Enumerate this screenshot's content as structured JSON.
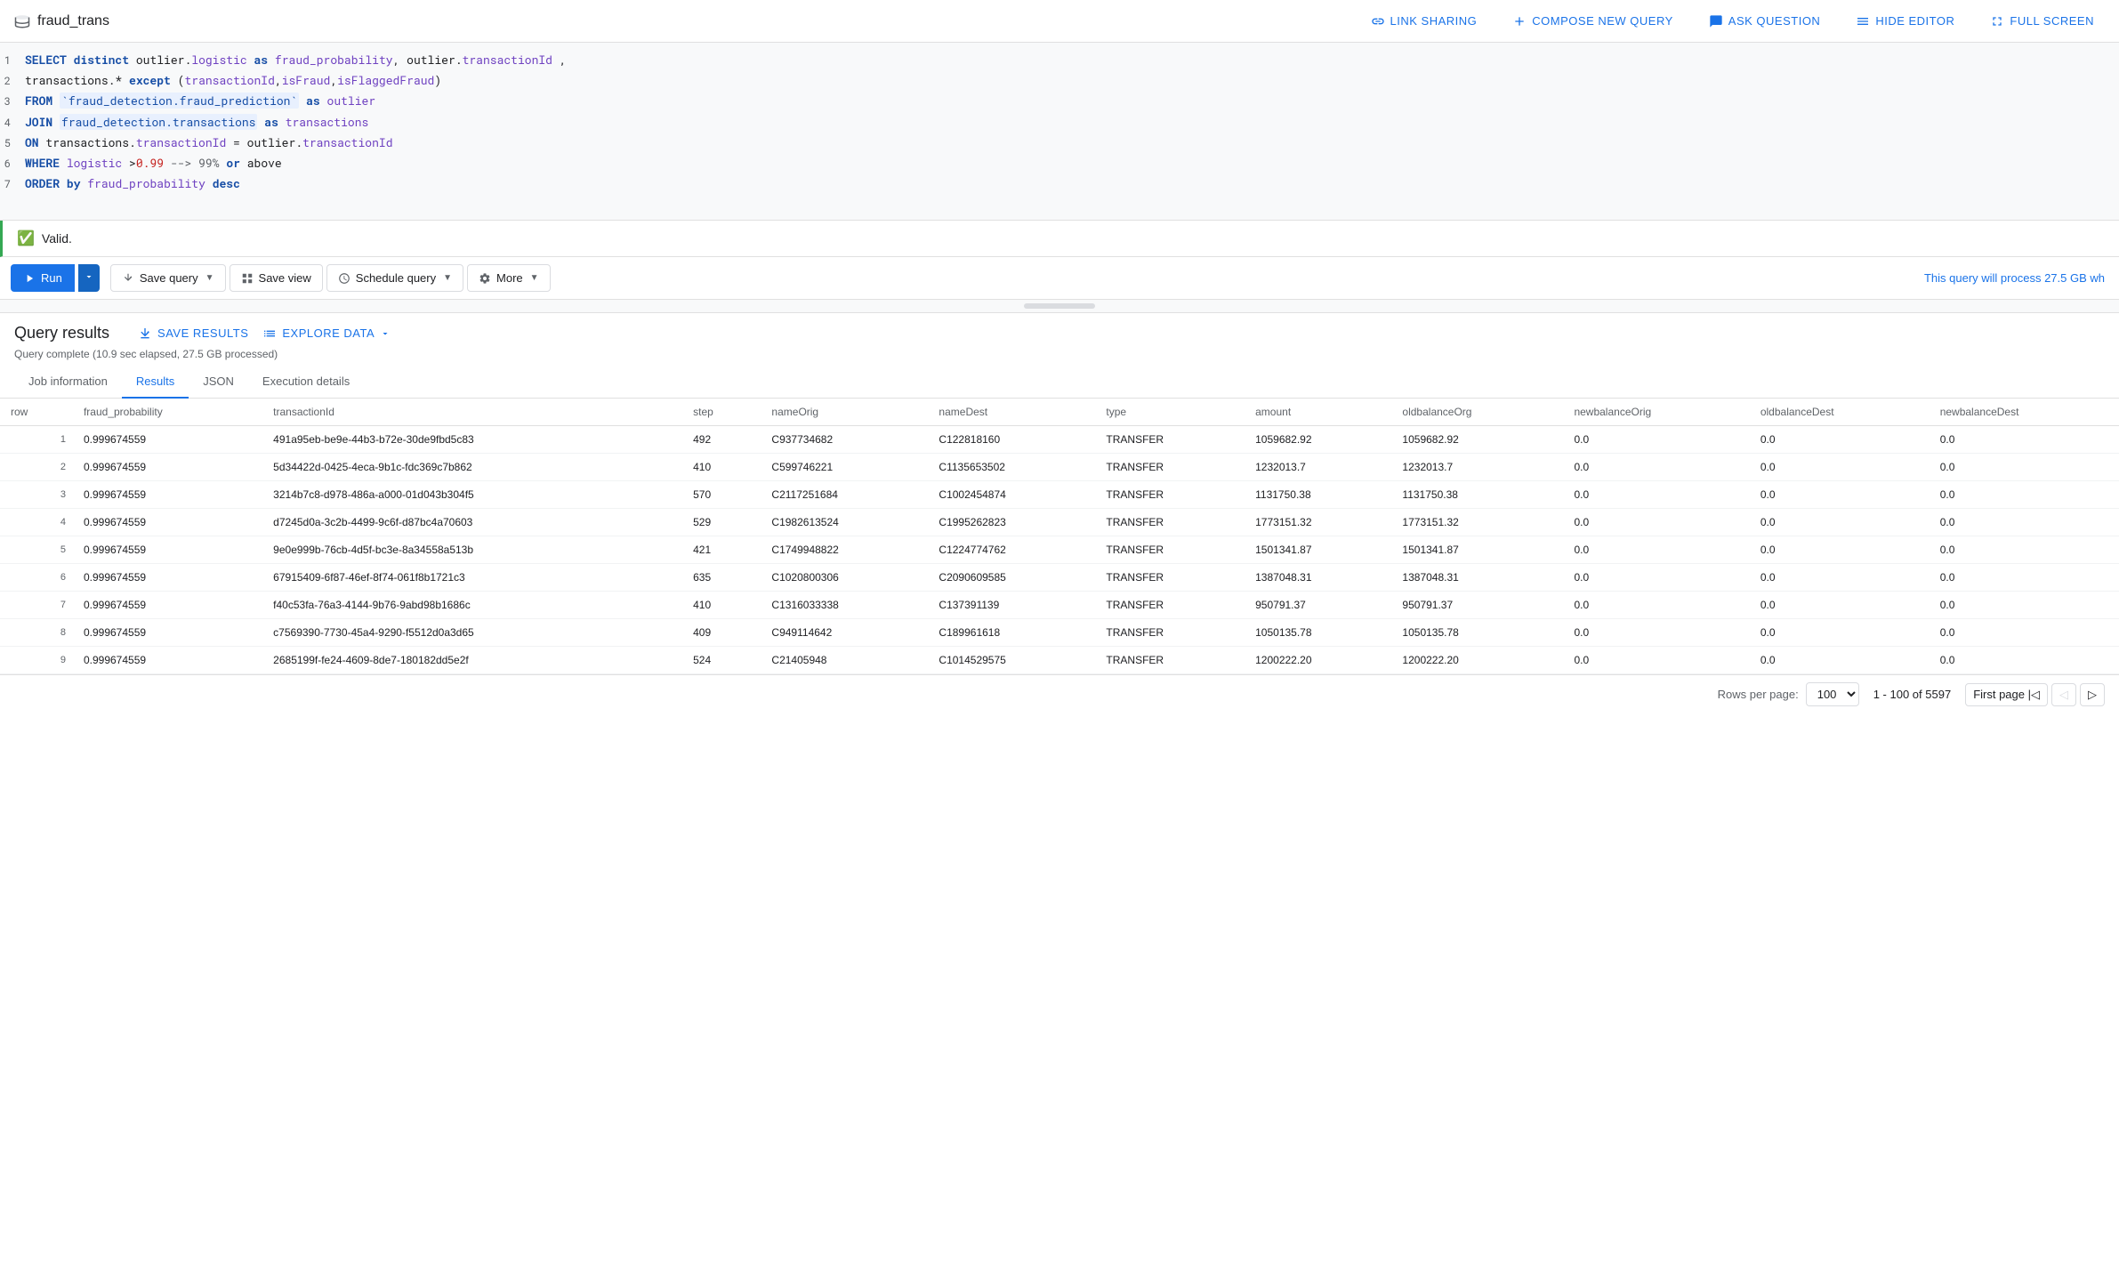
{
  "app": {
    "title": "fraud_trans",
    "icon": "database-icon"
  },
  "topbar": {
    "link_sharing": "LINK SHARING",
    "compose_query": "COMPOSE NEW QUERY",
    "ask_question": "ASK QUESTION",
    "hide_editor": "HIDE EDITOR",
    "fullscreen": "FULL SCREEN"
  },
  "editor": {
    "lines": [
      "SELECT distinct outlier.logistic as fraud_probability, outlier.transactionId ,",
      "transactions.* except (transactionId,isFraud,isFlaggedFraud)",
      "FROM `fraud_detection.fraud_prediction` as outlier",
      "JOIN fraud_detection.transactions as transactions",
      "ON transactions.transactionId = outlier.transactionId",
      "WHERE logistic >0.99 --> 99% or above",
      "ORDER by fraud_probability desc"
    ]
  },
  "valid": {
    "text": "Valid."
  },
  "toolbar": {
    "run": "Run",
    "save_query": "Save query",
    "save_view": "Save view",
    "schedule_query": "Schedule query",
    "more": "More",
    "process_text": "This query will process 27.5 GB wh"
  },
  "results": {
    "title": "Query results",
    "save_results": "SAVE RESULTS",
    "explore_data": "EXPLORE DATA",
    "status": "Query complete (10.9 sec elapsed, 27.5 GB processed)",
    "tabs": [
      "Job information",
      "Results",
      "JSON",
      "Execution details"
    ],
    "active_tab": "Results",
    "columns": [
      "row",
      "fraud_probability",
      "transactionId",
      "step",
      "nameOrig",
      "nameDest",
      "type",
      "amount",
      "oldbalanceOrg",
      "newbalanceOrig",
      "oldbalanceDest",
      "newbalanceDest"
    ],
    "rows": [
      [
        "",
        "0.999674559",
        "491a95eb-be9e-44b3-b72e-30de9fbd5c83",
        "492",
        "C937734682",
        "C122818160",
        "TRANSFER",
        "1059682.92",
        "1059682.92",
        "0.0",
        "0.0",
        "0.0"
      ],
      [
        "",
        "0.999674559",
        "5d34422d-0425-4eca-9b1c-fdc369c7b862",
        "410",
        "C599746221",
        "C1135653502",
        "TRANSFER",
        "1232013.7",
        "1232013.7",
        "0.0",
        "0.0",
        "0.0"
      ],
      [
        "",
        "0.999674559",
        "3214b7c8-d978-486a-a000-01d043b304f5",
        "570",
        "C2117251684",
        "C1002454874",
        "TRANSFER",
        "1131750.38",
        "1131750.38",
        "0.0",
        "0.0",
        "0.0"
      ],
      [
        "",
        "0.999674559",
        "d7245d0a-3c2b-4499-9c6f-d87bc4a70603",
        "529",
        "C1982613524",
        "C1995262823",
        "TRANSFER",
        "1773151.32",
        "1773151.32",
        "0.0",
        "0.0",
        "0.0"
      ],
      [
        "",
        "0.999674559",
        "9e0e999b-76cb-4d5f-bc3e-8a34558a513b",
        "421",
        "C1749948822",
        "C1224774762",
        "TRANSFER",
        "1501341.87",
        "1501341.87",
        "0.0",
        "0.0",
        "0.0"
      ],
      [
        "",
        "0.999674559",
        "67915409-6f87-46ef-8f74-061f8b1721c3",
        "635",
        "C1020800306",
        "C2090609585",
        "TRANSFER",
        "1387048.31",
        "1387048.31",
        "0.0",
        "0.0",
        "0.0"
      ],
      [
        "",
        "0.999674559",
        "f40c53fa-76a3-4144-9b76-9abd98b1686c",
        "410",
        "C1316033338",
        "C137391139",
        "TRANSFER",
        "950791.37",
        "950791.37",
        "0.0",
        "0.0",
        "0.0"
      ],
      [
        "",
        "0.999674559",
        "c7569390-7730-45a4-9290-f5512d0a3d65",
        "409",
        "C949114642",
        "C189961618",
        "TRANSFER",
        "1050135.78",
        "1050135.78",
        "0.0",
        "0.0",
        "0.0"
      ],
      [
        "",
        "0.999674559",
        "2685199f-fe24-4609-8de7-180182dd5e2f",
        "524",
        "C21405948",
        "C1014529575",
        "TRANSFER",
        "1200222.20",
        "1200222.20",
        "0.0",
        "0.0",
        "0.0"
      ]
    ],
    "pagination": {
      "rows_per_page_label": "Rows per page:",
      "rows_per_page_value": "100",
      "page_info": "1 - 100 of 5597",
      "first_page": "First page",
      "prev_page": "Previous page",
      "next_page": "Next page"
    }
  }
}
